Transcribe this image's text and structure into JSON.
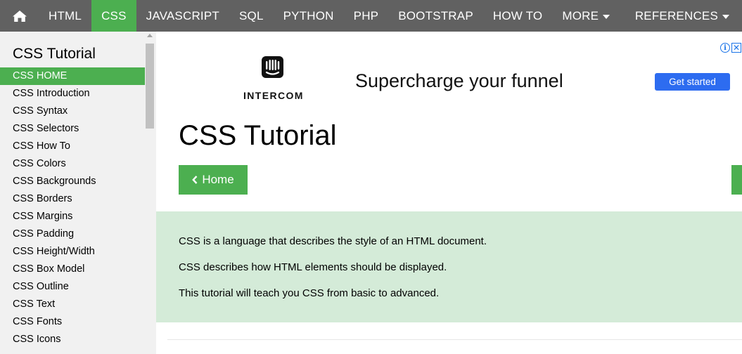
{
  "topnav": {
    "home_icon": "home-icon",
    "items": [
      {
        "label": "HTML",
        "active": false
      },
      {
        "label": "CSS",
        "active": true
      },
      {
        "label": "JAVASCRIPT",
        "active": false
      },
      {
        "label": "SQL",
        "active": false
      },
      {
        "label": "PYTHON",
        "active": false
      },
      {
        "label": "PHP",
        "active": false
      },
      {
        "label": "BOOTSTRAP",
        "active": false
      },
      {
        "label": "HOW TO",
        "active": false
      },
      {
        "label": "MORE",
        "active": false
      }
    ],
    "references_label": "REFERENCES",
    "colors": {
      "bar": "#616161",
      "active": "#4CAF50",
      "text": "#ffffff"
    }
  },
  "sidebar": {
    "title": "CSS Tutorial",
    "items": [
      {
        "label": "CSS HOME",
        "active": true
      },
      {
        "label": "CSS Introduction",
        "active": false
      },
      {
        "label": "CSS Syntax",
        "active": false
      },
      {
        "label": "CSS Selectors",
        "active": false
      },
      {
        "label": "CSS How To",
        "active": false
      },
      {
        "label": "CSS Colors",
        "active": false
      },
      {
        "label": "CSS Backgrounds",
        "active": false
      },
      {
        "label": "CSS Borders",
        "active": false
      },
      {
        "label": "CSS Margins",
        "active": false
      },
      {
        "label": "CSS Padding",
        "active": false
      },
      {
        "label": "CSS Height/Width",
        "active": false
      },
      {
        "label": "CSS Box Model",
        "active": false
      },
      {
        "label": "CSS Outline",
        "active": false
      },
      {
        "label": "CSS Text",
        "active": false
      },
      {
        "label": "CSS Fonts",
        "active": false
      },
      {
        "label": "CSS Icons",
        "active": false
      }
    ]
  },
  "ad": {
    "brand": "INTERCOM",
    "headline": "Supercharge your funnel",
    "cta": "Get started",
    "info_glyph": "i",
    "close_glyph": "✕",
    "cta_color": "#2d6cf0"
  },
  "main": {
    "title": "CSS Tutorial",
    "home_button": "Home",
    "intro": [
      "CSS is a language that describes the style of an HTML document.",
      "CSS describes how HTML elements should be displayed.",
      "This tutorial will teach you CSS from basic to advanced."
    ],
    "intro_bg": "#d4ebd8"
  }
}
